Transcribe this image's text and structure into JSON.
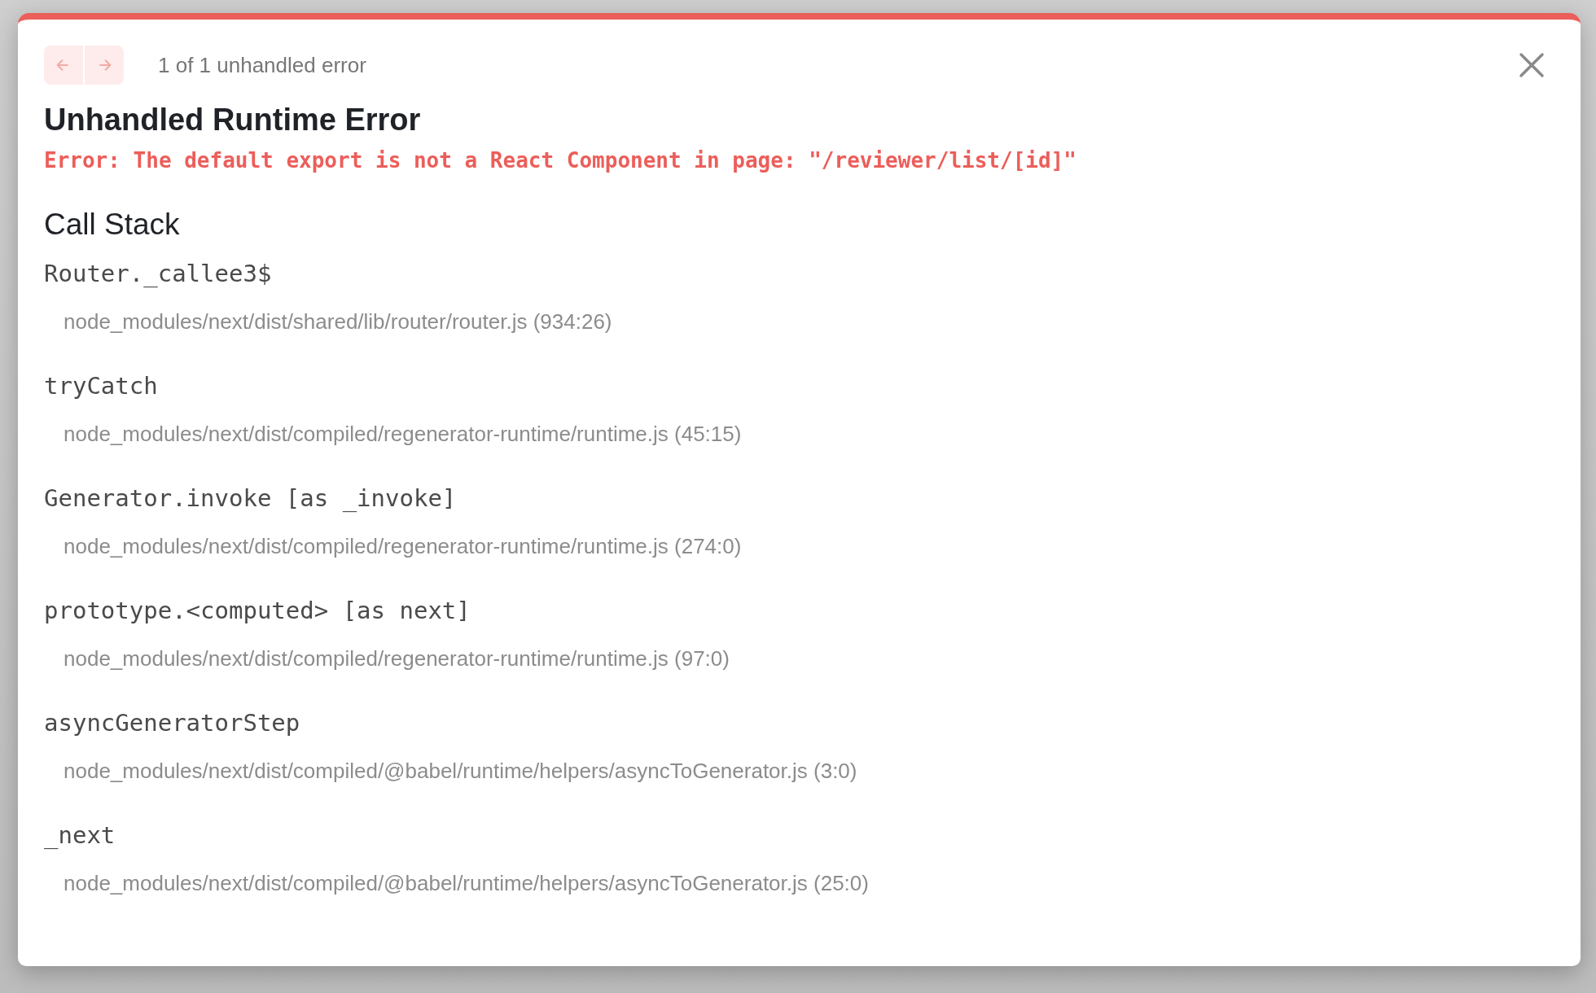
{
  "nav": {
    "buttons": [
      {
        "kind": "previous",
        "disabled": true
      },
      {
        "kind": "next",
        "disabled": true
      }
    ],
    "counter": "1 of 1 unhandled error"
  },
  "title": "Unhandled Runtime Error",
  "message": "Error: The default export is not a React Component in page: \"/reviewer/list/[id]\"",
  "call_stack": {
    "heading": "Call Stack",
    "frames": [
      {
        "function": "Router._callee3$",
        "location": "node_modules/next/dist/shared/lib/router/router.js (934:26)"
      },
      {
        "function": "tryCatch",
        "location": "node_modules/next/dist/compiled/regenerator-runtime/runtime.js (45:15)"
      },
      {
        "function": "Generator.invoke [as _invoke]",
        "location": "node_modules/next/dist/compiled/regenerator-runtime/runtime.js (274:0)"
      },
      {
        "function": "prototype.<computed> [as next]",
        "location": "node_modules/next/dist/compiled/regenerator-runtime/runtime.js (97:0)"
      },
      {
        "function": "asyncGeneratorStep",
        "location": "node_modules/next/dist/compiled/@babel/runtime/helpers/asyncToGenerator.js (3:0)"
      },
      {
        "function": "_next",
        "location": "node_modules/next/dist/compiled/@babel/runtime/helpers/asyncToGenerator.js (25:0)"
      }
    ]
  }
}
